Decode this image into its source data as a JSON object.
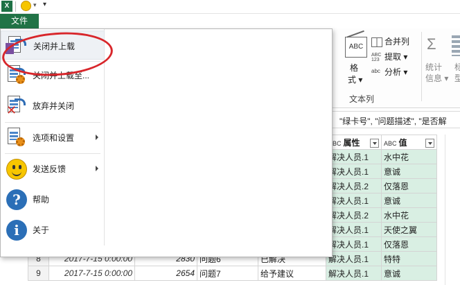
{
  "qat": {
    "app_icon": "excel-icon",
    "undo_icon": "smiley-icon"
  },
  "file_tab": {
    "label": "文件"
  },
  "menu": {
    "items": [
      {
        "label": "关闭并上载",
        "icon": "close-and-load-icon"
      },
      {
        "label": "关闭并上载至...",
        "icon": "close-and-load-to-icon"
      },
      {
        "label": "放弃并关闭",
        "icon": "discard-and-close-icon"
      },
      {
        "label": "选项和设置",
        "icon": "options-settings-icon"
      },
      {
        "label": "发送反馈",
        "icon": "smiley-feedback-icon"
      },
      {
        "label": "帮助",
        "icon": "help-icon",
        "glyph": "?"
      },
      {
        "label": "关于",
        "icon": "info-icon",
        "glyph": "i"
      }
    ]
  },
  "ribbon": {
    "format_line1": "格",
    "format_line2": "式",
    "merge_columns": "合并列",
    "extract": "提取",
    "parse": "分析",
    "abc123_glyph": "ABC\n123",
    "text_column_group": "文本列",
    "stats_line1": "统计",
    "stats_line2": "信息",
    "last_line1": "标",
    "last_line2": "型"
  },
  "formula_bar": {
    "text": "\"绿卡号\", \"问题描述\", \"是否解"
  },
  "table": {
    "headers": {
      "attr": "属性",
      "val": "值",
      "type_abc": "ABC"
    },
    "rows": [
      {
        "rn": "",
        "date": "",
        "num": "",
        "q": "",
        "st": "",
        "attr": "解决人员.1",
        "val": "水中花"
      },
      {
        "rn": "",
        "date": "",
        "num": "",
        "q": "",
        "st": "",
        "attr": "解决人员.1",
        "val": "意诚"
      },
      {
        "rn": "",
        "date": "",
        "num": "",
        "q": "",
        "st": "",
        "attr": "解决人员.2",
        "val": "仅落恩"
      },
      {
        "rn": "",
        "date": "",
        "num": "",
        "q": "",
        "st": "",
        "attr": "解决人员.1",
        "val": "意诚"
      },
      {
        "rn": "",
        "date": "",
        "num": "",
        "q": "",
        "st": "",
        "attr": "解决人员.2",
        "val": "水中花"
      },
      {
        "rn": "",
        "date": "",
        "num": "",
        "q": "",
        "st": "",
        "attr": "解决人员.1",
        "val": "天使之翼"
      },
      {
        "rn": "",
        "date": "",
        "num": "",
        "q": "",
        "st": "",
        "attr": "解决人员.1",
        "val": "仅落恩"
      },
      {
        "rn": "8",
        "date": "2017-7-15 0:00:00",
        "num": "2830",
        "q": "问题6",
        "st": "已解决",
        "attr": "解决人员.1",
        "val": "特特"
      },
      {
        "rn": "9",
        "date": "2017-7-15 0:00:00",
        "num": "2654",
        "q": "问题7",
        "st": "给予建议",
        "attr": "解决人员.1",
        "val": "意诚"
      }
    ]
  }
}
